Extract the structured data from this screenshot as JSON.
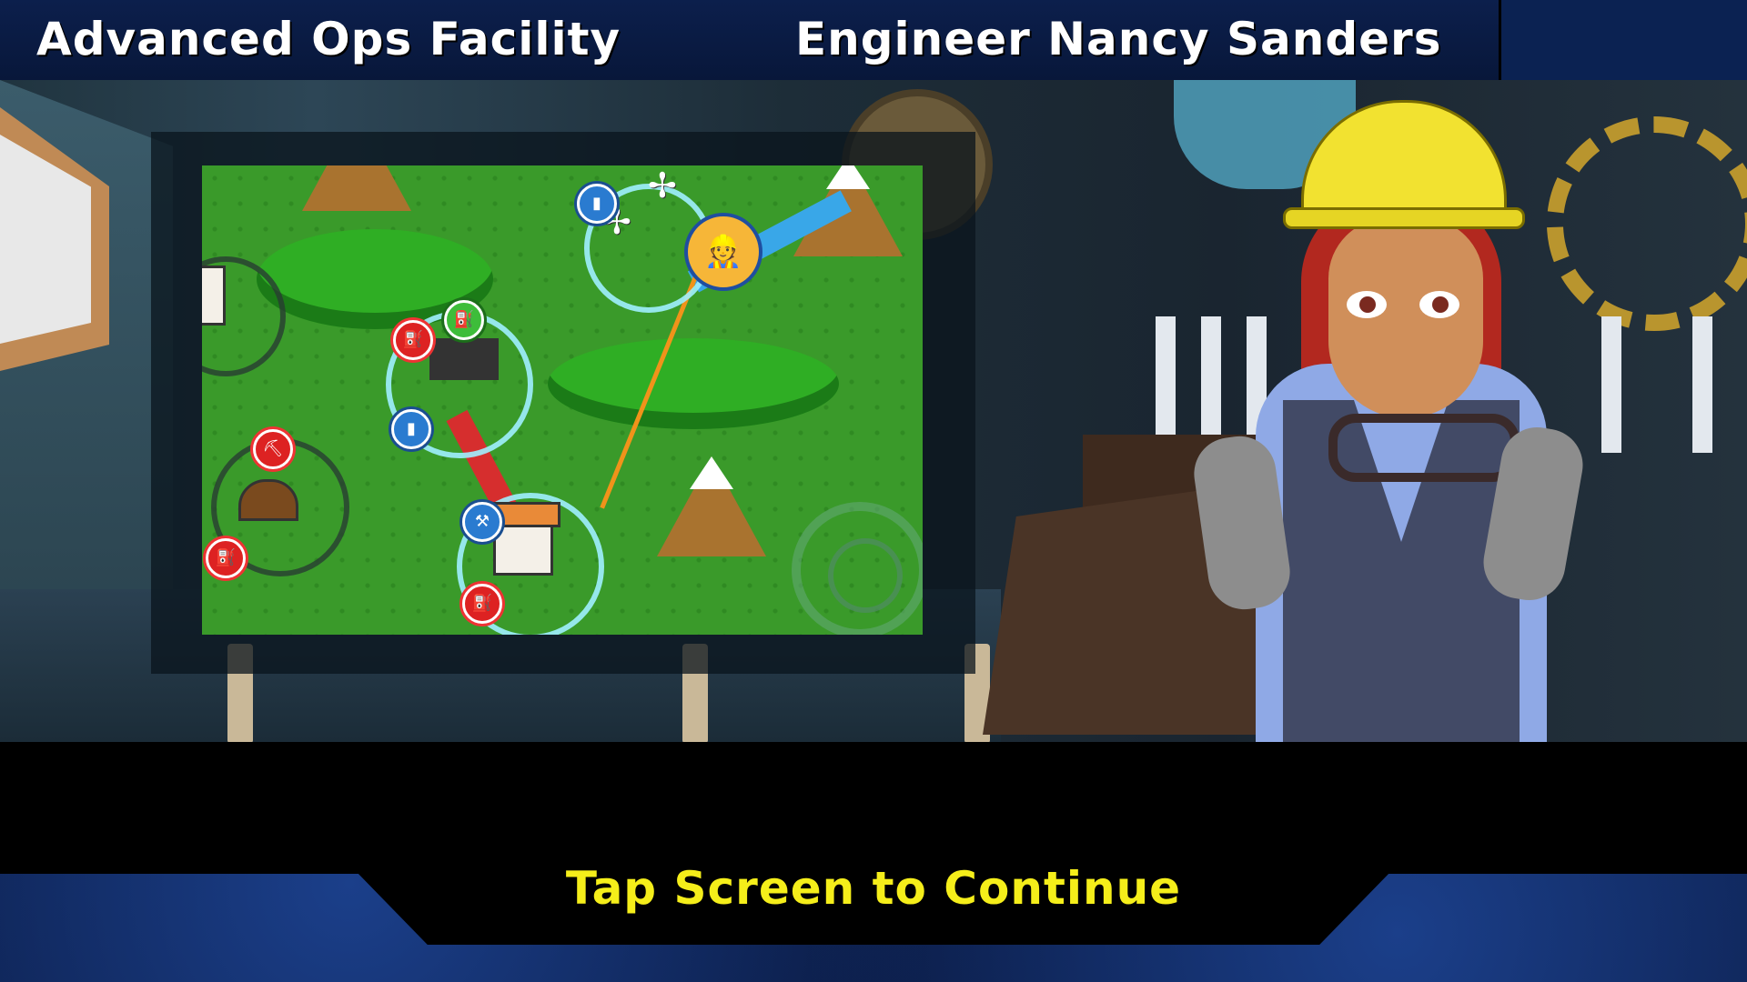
{
  "header": {
    "location": "Advanced Ops Facility",
    "speaker": "Engineer Nancy Sanders"
  },
  "footer": {
    "prompt": "Tap Screen to Continue"
  },
  "colors": {
    "prompt_text": "#f5ee1a",
    "header_text": "#ffffff",
    "frame_bg": "#0b1d47"
  },
  "map_icons": [
    "battery-icon",
    "fuel-icon",
    "wrench-icon",
    "tools-icon",
    "engineer-icon",
    "wind-turbine-icon",
    "clock-icon"
  ]
}
